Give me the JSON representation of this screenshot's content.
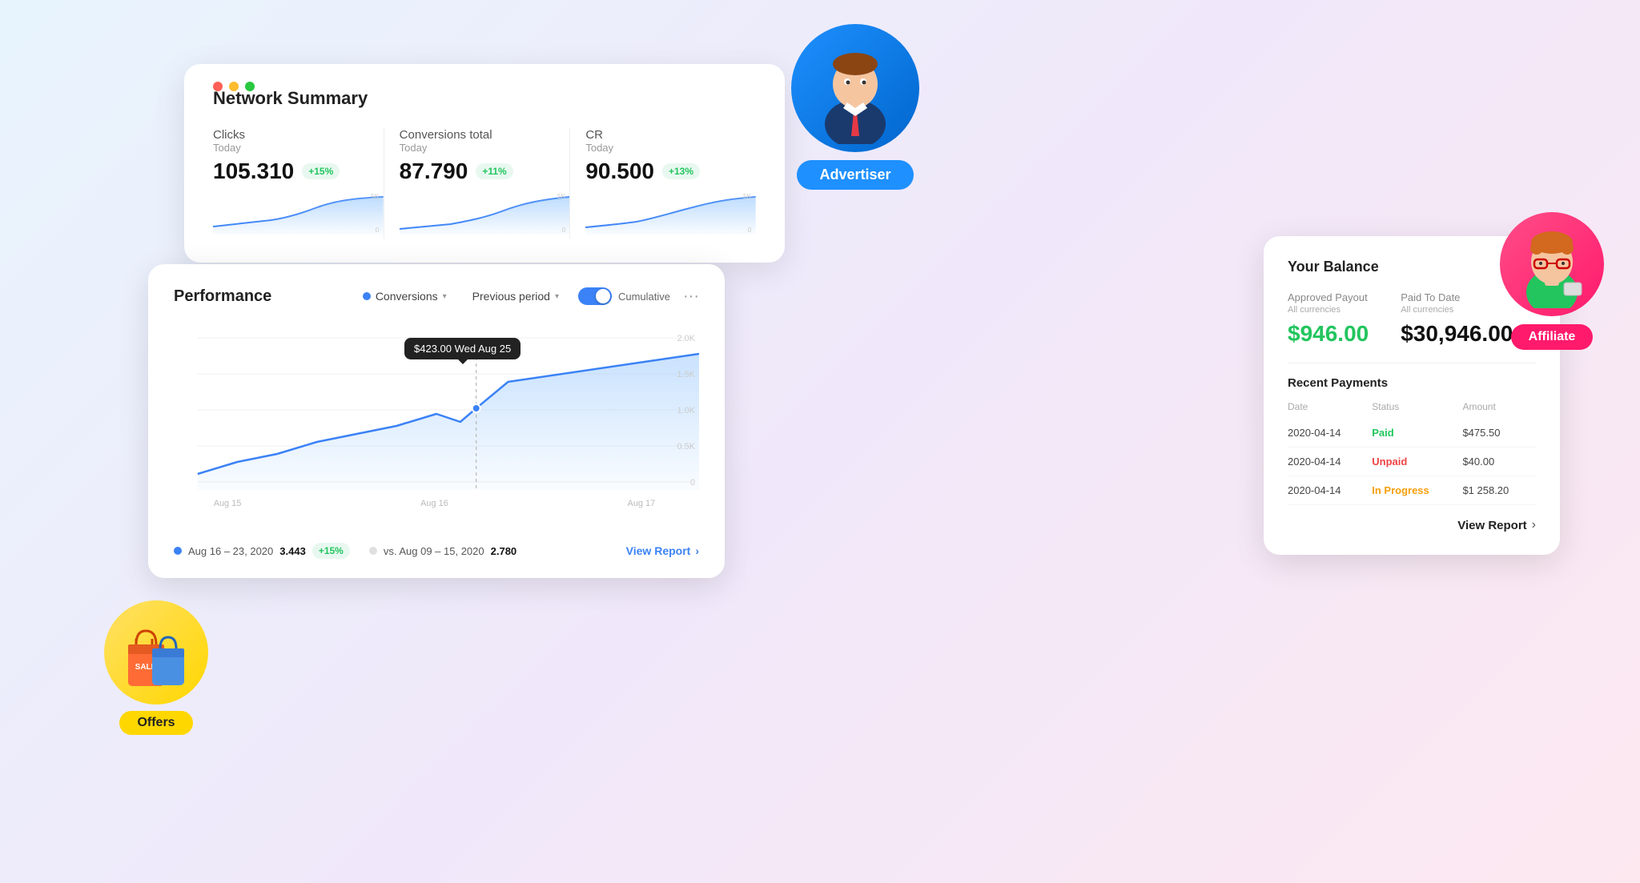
{
  "background": {
    "gradient": "linear-gradient(135deg, #e8f4fd 0%, #f0e8fa 50%, #fde8f0 100%)"
  },
  "network_card": {
    "title": "Network Summary",
    "dots": [
      "red",
      "yellow",
      "green"
    ],
    "metrics": [
      {
        "label": "Clicks",
        "sublabel": "Today",
        "value": "105.310",
        "badge": "+15%",
        "chart_y_max": "5K",
        "chart_y_min": "0"
      },
      {
        "label": "Conversions total",
        "sublabel": "Today",
        "value": "87.790",
        "badge": "+11%",
        "chart_y_max": "5K",
        "chart_y_min": "0"
      },
      {
        "label": "CR",
        "sublabel": "Today",
        "value": "90.500",
        "badge": "+13%",
        "chart_y_max": "5K",
        "chart_y_min": "0"
      }
    ]
  },
  "performance_card": {
    "title": "Performance",
    "dropdown_conversions": "Conversions",
    "dropdown_period": "Previous period",
    "toggle_label": "Cumulative",
    "toggle_state": "on",
    "tooltip_value": "$423.00",
    "tooltip_date": "Wed Aug 25",
    "y_axis": [
      "2.0K",
      "1.5K",
      "1.0K",
      "0.5K",
      "0"
    ],
    "x_axis": [
      "Aug 15",
      "Aug 16",
      "Aug 17"
    ],
    "footer": {
      "period1_label": "Aug 16 – 23, 2020",
      "period1_value": "3.443",
      "period1_badge": "+15%",
      "period2_label": "vs. Aug 09 – 15, 2020",
      "period2_value": "2.780",
      "view_report": "View Report"
    }
  },
  "balance_card": {
    "title": "Your Balance",
    "approved_payout_label": "Approved Payout",
    "approved_payout_sublabel": "All currencies",
    "approved_payout_value": "$946.00",
    "paid_to_date_label": "Paid To Date",
    "paid_to_date_sublabel": "All currencies",
    "paid_to_date_value": "$30,946.00",
    "recent_payments_title": "Recent Payments",
    "table_headers": [
      "Date",
      "Status",
      "Amount"
    ],
    "payments": [
      {
        "date": "2020-04-14",
        "status": "Paid",
        "status_type": "paid",
        "amount": "$475.50"
      },
      {
        "date": "2020-04-14",
        "status": "Unpaid",
        "status_type": "unpaid",
        "amount": "$40.00"
      },
      {
        "date": "2020-04-14",
        "status": "In Progress",
        "status_type": "progress",
        "amount": "$1 258.20"
      }
    ],
    "view_report": "View Report"
  },
  "advertiser": {
    "label": "Advertiser"
  },
  "affiliate": {
    "label": "Affiliate"
  },
  "offers": {
    "label": "Offers"
  }
}
